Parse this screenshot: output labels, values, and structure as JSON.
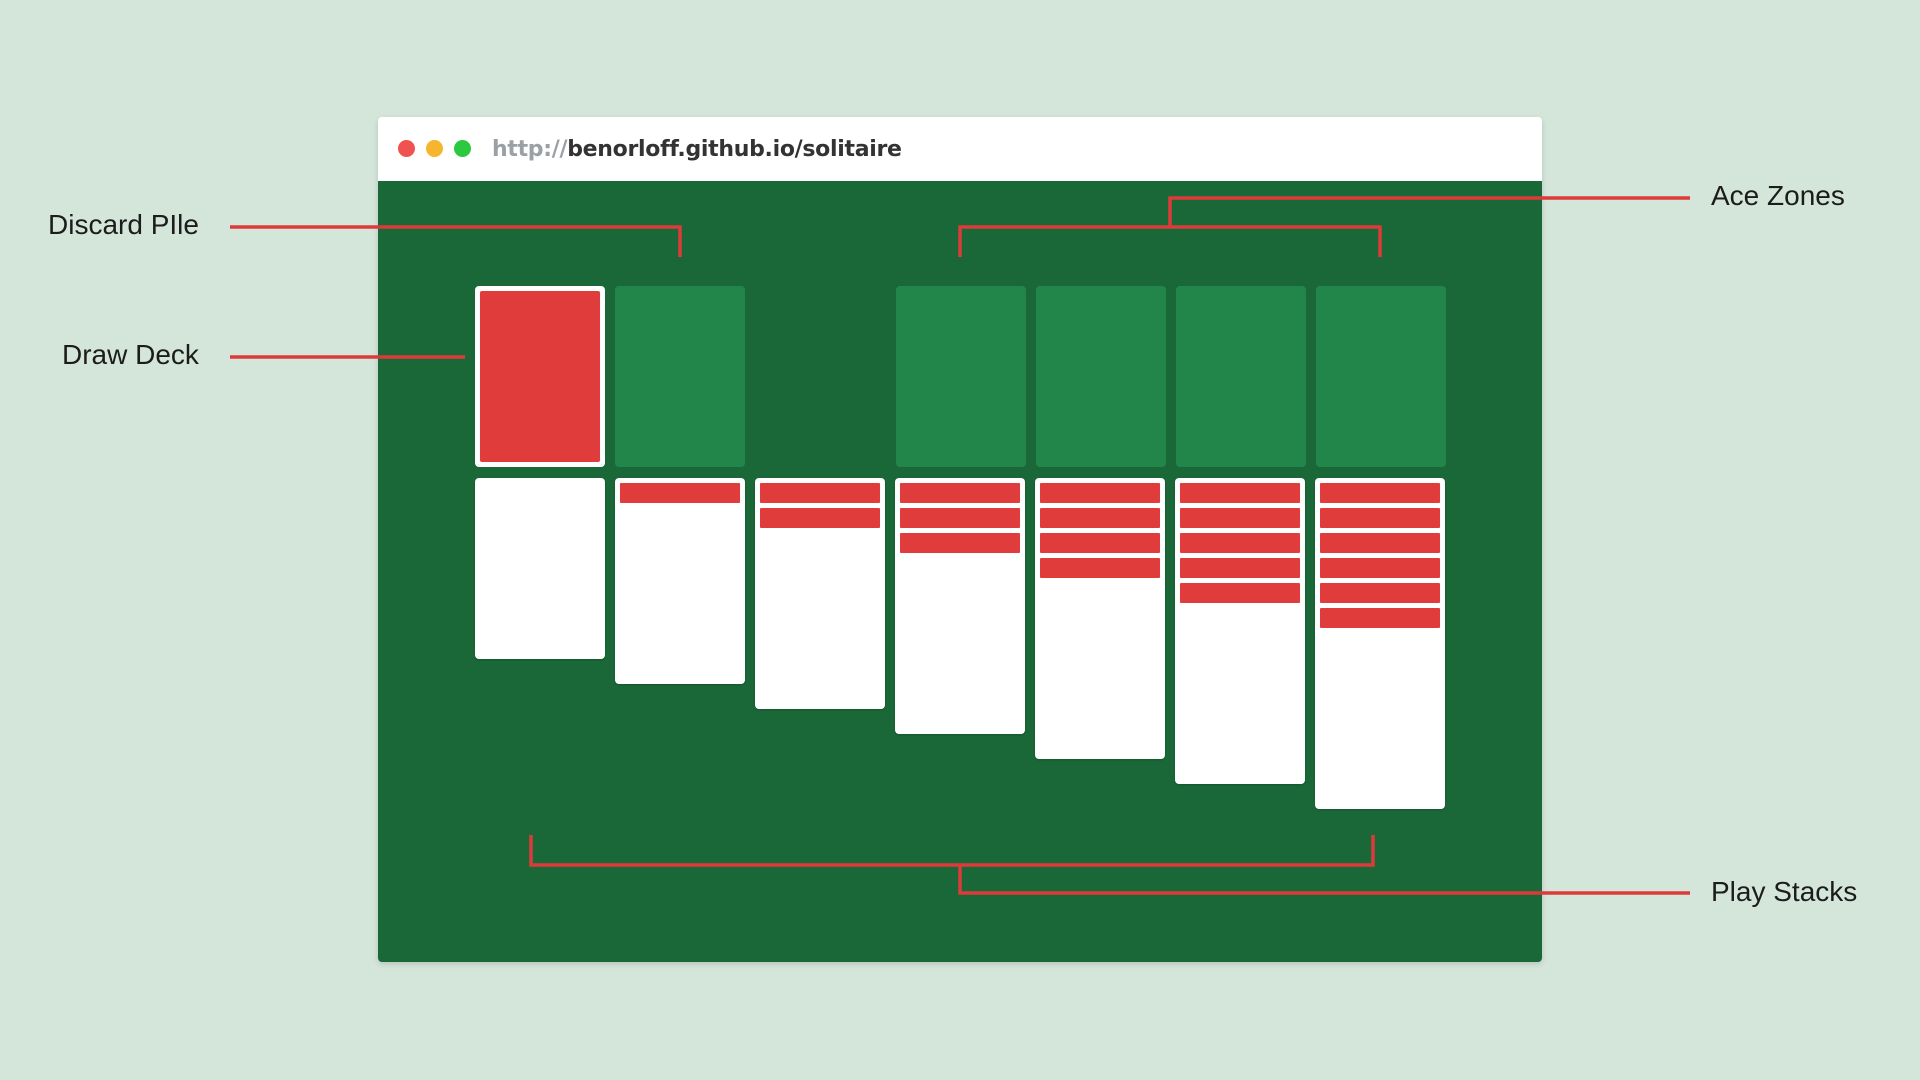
{
  "browser": {
    "url_protocol": "http://",
    "url_host": "benorloff.github.io/solitaire",
    "traffic_lights": [
      {
        "name": "close",
        "color": "#f0524f"
      },
      {
        "name": "minimize",
        "color": "#f6b52e"
      },
      {
        "name": "maximize",
        "color": "#2cc840"
      }
    ]
  },
  "colors": {
    "felt": "#1a6838",
    "empty_slot": "#22854a",
    "card_back": "#e03c3c",
    "card_face": "#ffffff",
    "callout_line": "#de3a3a"
  },
  "game": {
    "draw_deck": {
      "cards_shown": 1
    },
    "discard_pile": {
      "cards": 0
    },
    "ace_zones": {
      "count": 4,
      "cards": [
        0,
        0,
        0,
        0
      ]
    },
    "play_stacks": {
      "count": 7,
      "face_down_counts": [
        0,
        1,
        2,
        3,
        4,
        5,
        6
      ],
      "face_up_counts": [
        1,
        1,
        1,
        1,
        1,
        1,
        1
      ]
    }
  },
  "annotations": {
    "discard_pile": "Discard PIle",
    "draw_deck": "Draw Deck",
    "ace_zones": "Ace Zones",
    "play_stacks": "Play Stacks"
  }
}
